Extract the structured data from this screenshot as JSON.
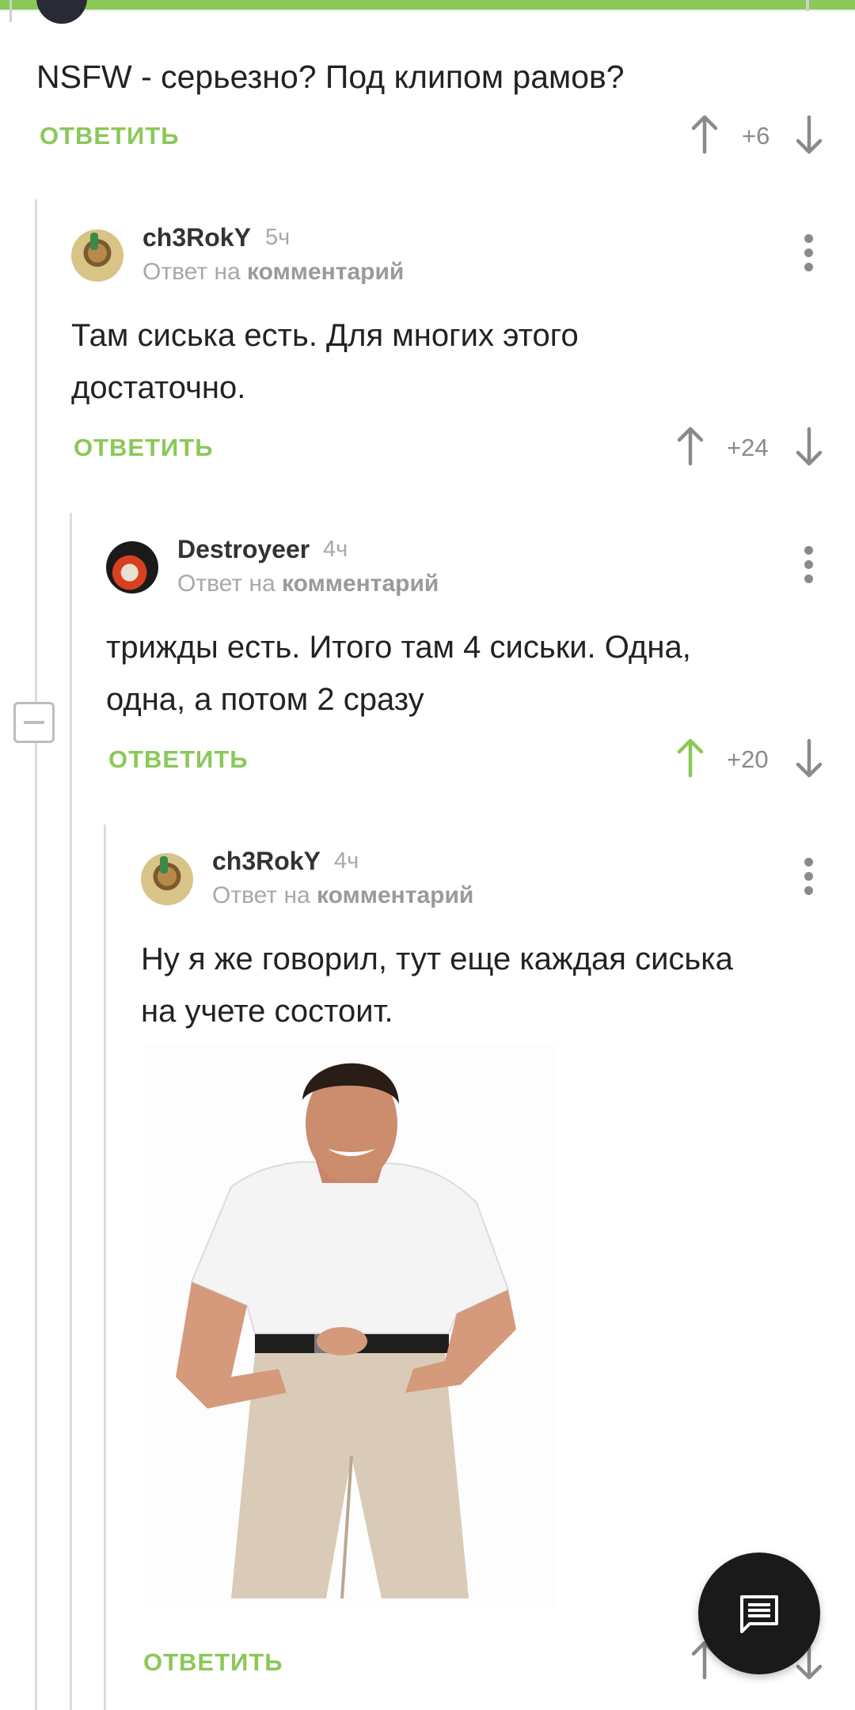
{
  "parent_comment": {
    "text": "NSFW - серьезно? Под клипом рамов?",
    "reply_label": "ОТВЕТИТЬ",
    "score": "+6"
  },
  "comments": [
    {
      "author": "ch3RokY",
      "time": "5ч",
      "reply_to_prefix": "Ответ на",
      "reply_to_link": "комментарий",
      "text_line1": "Там сиська есть. Для многих этого",
      "text_line2": "достаточно.",
      "reply_label": "ОТВЕТИТЬ",
      "score": "+24"
    },
    {
      "author": "Destroyeer",
      "time": "4ч",
      "reply_to_prefix": "Ответ на",
      "reply_to_link": "комментарий",
      "text_line1": "трижды есть. Итого там 4 сиськи. Одна,",
      "text_line2": "одна, а потом 2 сразу",
      "reply_label": "ОТВЕТИТЬ",
      "score": "+20",
      "upvoted": true
    },
    {
      "author": "ch3RokY",
      "time": "4ч",
      "reply_to_prefix": "Ответ на",
      "reply_to_link": "комментарий",
      "text_line1": "Ну я же говорил, тут еще каждая сиська",
      "text_line2": "на учете состоит.",
      "reply_label": "ОТВЕТИТЬ",
      "has_image": true
    }
  ],
  "icons": {
    "upvote": "arrow-up-icon",
    "downvote": "arrow-down-icon",
    "more": "more-vertical-icon",
    "collapse": "collapse-minus-icon",
    "fab": "comment-icon"
  },
  "colors": {
    "accent": "#8ac858",
    "text": "#222222",
    "muted": "#a8a8a8",
    "fab": "#1a1a1a"
  }
}
